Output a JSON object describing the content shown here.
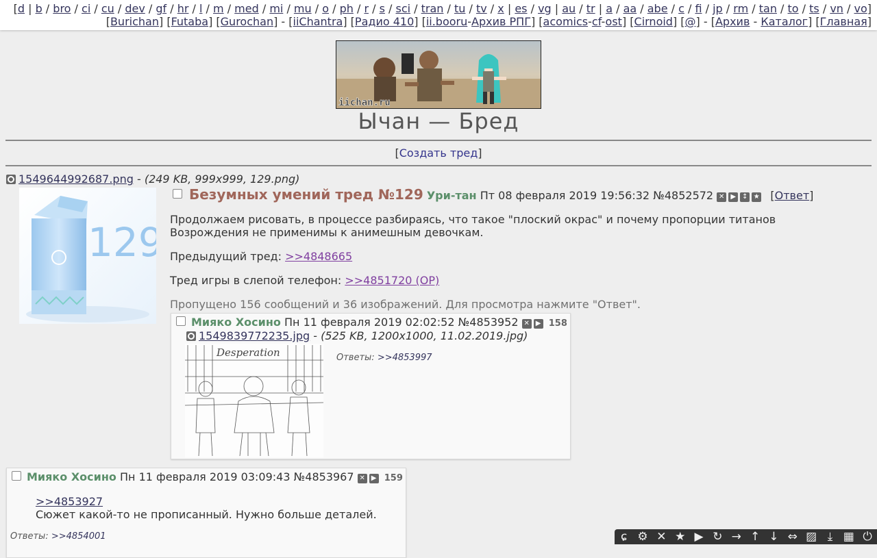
{
  "topnav": {
    "row1": [
      {
        "type": "text",
        "text": "["
      },
      {
        "type": "link",
        "text": "d"
      },
      {
        "type": "text",
        "text": " | "
      },
      {
        "type": "link",
        "text": "b"
      },
      {
        "type": "text",
        "text": " / "
      },
      {
        "type": "link",
        "text": "bro"
      },
      {
        "type": "text",
        "text": " / "
      },
      {
        "type": "link",
        "text": "ci"
      },
      {
        "type": "text",
        "text": " / "
      },
      {
        "type": "link",
        "text": "cu"
      },
      {
        "type": "text",
        "text": " / "
      },
      {
        "type": "link",
        "text": "dev"
      },
      {
        "type": "text",
        "text": " / "
      },
      {
        "type": "link",
        "text": "gf"
      },
      {
        "type": "text",
        "text": " / "
      },
      {
        "type": "link",
        "text": "hr"
      },
      {
        "type": "text",
        "text": " / "
      },
      {
        "type": "link",
        "text": "l"
      },
      {
        "type": "text",
        "text": " / "
      },
      {
        "type": "link",
        "text": "m"
      },
      {
        "type": "text",
        "text": " / "
      },
      {
        "type": "link",
        "text": "med"
      },
      {
        "type": "text",
        "text": " / "
      },
      {
        "type": "link",
        "text": "mi"
      },
      {
        "type": "text",
        "text": " / "
      },
      {
        "type": "link",
        "text": "mu"
      },
      {
        "type": "text",
        "text": " / "
      },
      {
        "type": "link",
        "text": "o"
      },
      {
        "type": "text",
        "text": " / "
      },
      {
        "type": "link",
        "text": "ph"
      },
      {
        "type": "text",
        "text": " / "
      },
      {
        "type": "link",
        "text": "r"
      },
      {
        "type": "text",
        "text": " / "
      },
      {
        "type": "link",
        "text": "s"
      },
      {
        "type": "text",
        "text": " / "
      },
      {
        "type": "link",
        "text": "sci"
      },
      {
        "type": "text",
        "text": " / "
      },
      {
        "type": "link",
        "text": "tran"
      },
      {
        "type": "text",
        "text": " / "
      },
      {
        "type": "link",
        "text": "tu"
      },
      {
        "type": "text",
        "text": " / "
      },
      {
        "type": "link",
        "text": "tv"
      },
      {
        "type": "text",
        "text": " / "
      },
      {
        "type": "link",
        "text": "x"
      },
      {
        "type": "text",
        "text": " | "
      },
      {
        "type": "link",
        "text": "es"
      },
      {
        "type": "text",
        "text": " / "
      },
      {
        "type": "link",
        "text": "vg"
      },
      {
        "type": "text",
        "text": " | "
      },
      {
        "type": "link",
        "text": "au"
      },
      {
        "type": "text",
        "text": " / "
      },
      {
        "type": "link",
        "text": "tr"
      },
      {
        "type": "text",
        "text": " | "
      },
      {
        "type": "link",
        "text": "a"
      },
      {
        "type": "text",
        "text": " / "
      },
      {
        "type": "link",
        "text": "aa"
      },
      {
        "type": "text",
        "text": " / "
      },
      {
        "type": "link",
        "text": "abe"
      },
      {
        "type": "text",
        "text": " / "
      },
      {
        "type": "link",
        "text": "c"
      },
      {
        "type": "text",
        "text": " / "
      },
      {
        "type": "link",
        "text": "fi"
      },
      {
        "type": "text",
        "text": " / "
      },
      {
        "type": "link",
        "text": "jp"
      },
      {
        "type": "text",
        "text": " / "
      },
      {
        "type": "link",
        "text": "rm"
      },
      {
        "type": "text",
        "text": " / "
      },
      {
        "type": "link",
        "text": "tan"
      },
      {
        "type": "text",
        "text": " / "
      },
      {
        "type": "link",
        "text": "to"
      },
      {
        "type": "text",
        "text": " / "
      },
      {
        "type": "link",
        "text": "ts"
      },
      {
        "type": "text",
        "text": " / "
      },
      {
        "type": "link",
        "text": "vn"
      },
      {
        "type": "text",
        "text": " / "
      },
      {
        "type": "link",
        "text": "vo"
      },
      {
        "type": "text",
        "text": "]"
      }
    ],
    "row2": [
      {
        "type": "text",
        "text": "["
      },
      {
        "type": "link",
        "text": "Burichan"
      },
      {
        "type": "text",
        "text": "] ["
      },
      {
        "type": "link",
        "text": "Futaba"
      },
      {
        "type": "text",
        "text": "] ["
      },
      {
        "type": "link",
        "text": "Gurochan"
      },
      {
        "type": "text",
        "text": "] - ["
      },
      {
        "type": "link",
        "text": "iiChantra"
      },
      {
        "type": "text",
        "text": "] ["
      },
      {
        "type": "link",
        "text": "Радио 410"
      },
      {
        "type": "text",
        "text": "] ["
      },
      {
        "type": "link",
        "text": "ii.booru"
      },
      {
        "type": "text",
        "text": "-"
      },
      {
        "type": "link",
        "text": "Архив РПГ"
      },
      {
        "type": "text",
        "text": "] ["
      },
      {
        "type": "link",
        "text": "acomics"
      },
      {
        "type": "text",
        "text": "-"
      },
      {
        "type": "link",
        "text": "cf"
      },
      {
        "type": "text",
        "text": "-"
      },
      {
        "type": "link",
        "text": "ost"
      },
      {
        "type": "text",
        "text": "] ["
      },
      {
        "type": "link",
        "text": "Cirnoid"
      },
      {
        "type": "text",
        "text": "] ["
      },
      {
        "type": "link",
        "text": "@"
      },
      {
        "type": "text",
        "text": "] - ["
      },
      {
        "type": "link",
        "text": "Архив"
      },
      {
        "type": "text",
        "text": " - "
      },
      {
        "type": "link",
        "text": "Каталог"
      },
      {
        "type": "text",
        "text": "] ["
      },
      {
        "type": "link",
        "text": "Главная"
      },
      {
        "type": "text",
        "text": "]"
      }
    ]
  },
  "header": {
    "logo_text": "iichan.ru",
    "board_title": "Ычан — Бред",
    "create_open": "[",
    "create_thread": "Создать тред",
    "create_close": "]"
  },
  "op": {
    "file_name": "1549644992687.png",
    "file_dash": " - ",
    "file_meta": "(249 KB, 999x999, 129.png)",
    "thumb_text": "129",
    "subject": "Безумных умений тред №129",
    "name": "Ури-тан",
    "date": "Пт 08 февраля 2019 19:56:32",
    "number": "№4852572",
    "reply_open": "[",
    "reply_label": "Ответ",
    "reply_close": "]",
    "text1": "Продолжаем рисовать, в процессе разбираясь, что такое \"плоский окрас\" и почему пропорции титанов Возрождения не применимы к анимешным девочкам.",
    "prev_label": "Предыдущий тред: ",
    "prev_link": ">>4848665",
    "game_label": "Тред игры в слепой телефон: ",
    "game_link": ">>4851720 (OP)",
    "omitted": "Пропущено 156 сообщений и 36 изображений. Для просмотра нажмите \"Ответ\"."
  },
  "reply1": {
    "name": "Мияко Хосино",
    "date": "Пн 11 февраля 2019 02:02:52",
    "number": "№4853952",
    "count": "158",
    "file_name": "1549839772235.jpg",
    "file_dash": " - ",
    "file_meta": "(525 KB, 1200x1000, 11.02.2019.jpg)",
    "sketch_title": "Desperation",
    "answers_label": "Ответы: ",
    "answers_link": ">>4853997"
  },
  "reply2": {
    "name": "Мияко Хосино",
    "date": "Пн 11 февраля 2019 03:09:43",
    "number": "№4853967",
    "count": "159",
    "quote_link": ">>4853927",
    "text": "Сюжет какой-то не прописанный. Нужно больше деталей.",
    "answers_label": "Ответы: ",
    "answers_link": ">>4854001"
  },
  "toolbar": {
    "icons": [
      "ɕ",
      "⚙",
      "✕",
      "★",
      "▶",
      "↻",
      "→",
      "↑",
      "↓",
      "⇔",
      "▨",
      "⤓",
      "▦",
      "⏻"
    ]
  },
  "colors": {
    "background": "#eeeeee",
    "subject": "#a0665a",
    "name": "#5b8f6a",
    "link": "#34345c",
    "quote": "#8040a0"
  }
}
